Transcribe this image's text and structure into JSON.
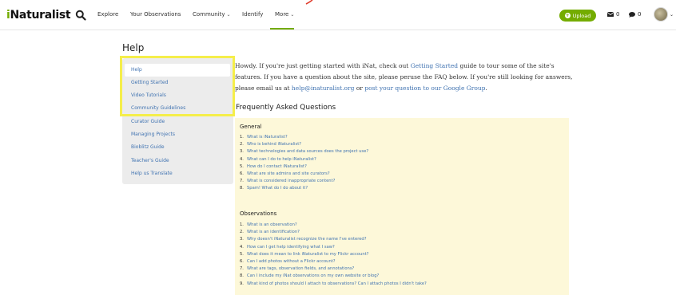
{
  "header": {
    "logo": {
      "prefix": "i",
      "text": "Naturalist"
    },
    "nav": [
      {
        "label": "Explore",
        "has_dropdown": false
      },
      {
        "label": "Your Observations",
        "has_dropdown": false
      },
      {
        "label": "Community",
        "has_dropdown": true
      },
      {
        "label": "Identify",
        "has_dropdown": false
      },
      {
        "label": "More",
        "has_dropdown": true
      }
    ],
    "upload_label": "Upload",
    "messages_count": "0",
    "notifications_count": "0",
    "brand_color": "#74ac00"
  },
  "page_title": "Help",
  "sidebar": {
    "items": [
      {
        "label": "Help",
        "active": true
      },
      {
        "label": "Getting Started",
        "active": false
      },
      {
        "label": "Video Tutorials",
        "active": false
      },
      {
        "label": "Community Guidelines",
        "active": false
      },
      {
        "label": "Curator Guide",
        "active": false
      },
      {
        "label": "Managing Projects",
        "active": false
      },
      {
        "label": "Bioblitz Guide",
        "active": false
      },
      {
        "label": "Teacher's Guide",
        "active": false
      },
      {
        "label": "Help us Translate",
        "active": false
      }
    ]
  },
  "intro": {
    "t1": "Howdy. If you're just getting started with iNat, check out ",
    "link1": "Getting Started",
    "t2": " guide to tour some of the site's features. If you have a question about the site, please peruse the FAQ below. If you're still looking for answers, please email us at ",
    "link2": "help@inaturalist.org",
    "t3": " or ",
    "link3": "post your question to our Google Group",
    "t4": "."
  },
  "faq": {
    "title": "Frequently Asked Questions",
    "sections": [
      {
        "heading": "General",
        "questions": [
          {
            "num": "1.",
            "text": "What is iNaturalist?"
          },
          {
            "num": "2.",
            "text": "Who is behind iNaturalist?"
          },
          {
            "num": "3.",
            "text": "What technologies and data sources does the project use?"
          },
          {
            "num": "4.",
            "text": "What can I do to help iNaturalist?"
          },
          {
            "num": "5.",
            "text": "How do I contact iNaturalist?"
          },
          {
            "num": "6.",
            "text": "What are site admins and site curators?"
          },
          {
            "num": "7.",
            "text": "What is considered inappropriate content?"
          },
          {
            "num": "8.",
            "text": "Spam! What do I do about it?"
          }
        ]
      },
      {
        "heading": "Observations",
        "questions": [
          {
            "num": "1.",
            "text": "What is an observation?"
          },
          {
            "num": "2.",
            "text": "What is an identification?"
          },
          {
            "num": "3.",
            "text": "Why doesn't iNaturalist recognize the name I've entered?"
          },
          {
            "num": "4.",
            "text": "How can I get help identifying what I saw?"
          },
          {
            "num": "5.",
            "text": "What does it mean to link iNaturalist to my Flickr account?"
          },
          {
            "num": "6.",
            "text": "Can I add photos without a Flickr account?"
          },
          {
            "num": "7.",
            "text": "What are tags, observation fields, and annotations?"
          },
          {
            "num": "8.",
            "text": "Can I include my iNat observations on my own website or blog?"
          },
          {
            "num": "9.",
            "text": "What kind of photos should I attach to observations? Can I attach photos I didn't take?"
          }
        ]
      }
    ]
  }
}
